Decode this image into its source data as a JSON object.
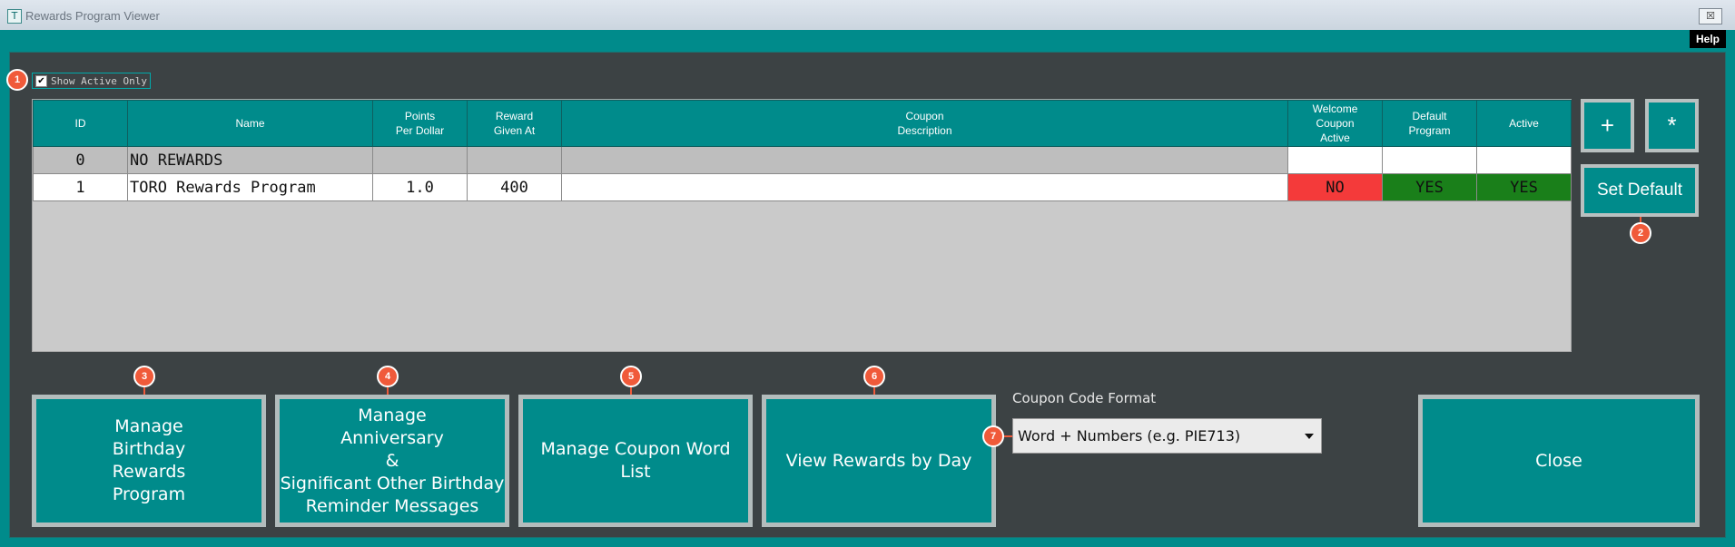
{
  "window": {
    "title": "Rewards Program Viewer",
    "close_glyph": "☒",
    "icon": "app-icon"
  },
  "help": {
    "label": "Help"
  },
  "filter": {
    "checkbox_label": "Show Active Only",
    "checked": true
  },
  "table": {
    "headers": {
      "id": "ID",
      "name": "Name",
      "points": "Points\nPer Dollar",
      "reward": "Reward\nGiven At",
      "coupon": "Coupon\nDescription",
      "welcome": "Welcome\nCoupon\nActive",
      "default": "Default\nProgram",
      "active": "Active"
    },
    "rows": [
      {
        "id": "0",
        "name": "NO REWARDS",
        "points": "",
        "reward": "",
        "coupon": "",
        "welcome": "",
        "default": "",
        "active": ""
      },
      {
        "id": "1",
        "name": "TORO Rewards Program",
        "points": "1.0",
        "reward": "400",
        "coupon": "",
        "welcome": "NO",
        "default": "YES",
        "active": "YES"
      }
    ]
  },
  "side_buttons": {
    "add": "+",
    "star": "*",
    "set_default": "Set Default"
  },
  "bottom_buttons": {
    "birthday": "Manage\nBirthday\nRewards\nProgram",
    "anniversary": "Manage\nAnniversary\n&\nSignificant Other Birthday\nReminder Messages",
    "coupon_words": "Manage Coupon Word List",
    "rewards_by_day": "View Rewards by Day",
    "close": "Close"
  },
  "coupon_format": {
    "label": "Coupon Code Format",
    "selected": "Word + Numbers (e.g. PIE713)"
  },
  "annotations": [
    "1",
    "2",
    "3",
    "4",
    "5",
    "6",
    "7"
  ],
  "colors": {
    "accent": "#008b8b",
    "panel": "#3c4244",
    "no": "#f43a3a",
    "yes": "#1a7f1a",
    "marker": "#f05a3a"
  }
}
